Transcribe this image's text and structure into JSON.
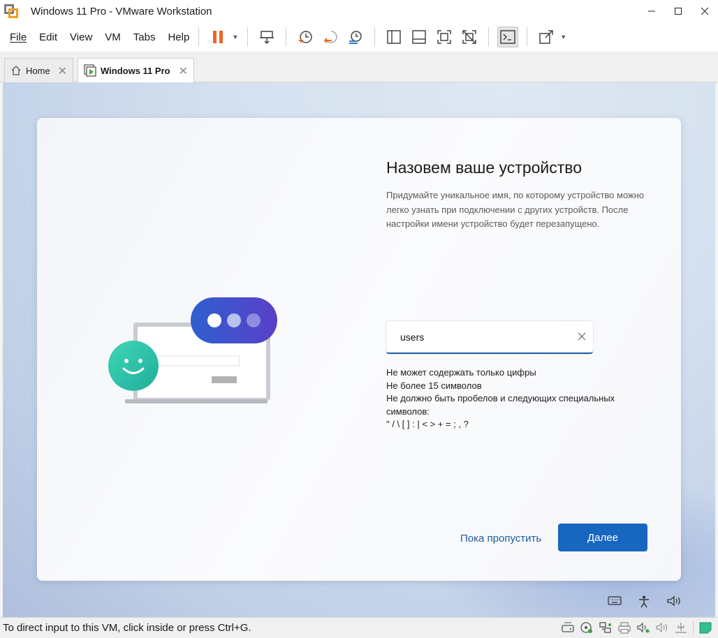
{
  "window": {
    "title": "Windows 11 Pro - VMware Workstation",
    "controls": {
      "minimize": "—",
      "maximize": "☐",
      "close": "✕"
    }
  },
  "menu": {
    "items": [
      "File",
      "Edit",
      "View",
      "VM",
      "Tabs",
      "Help"
    ]
  },
  "toolbar": {
    "icons": [
      "pause-icon",
      "send-ctrl-alt-del-icon",
      "snapshot-icon",
      "revert-snapshot-icon",
      "snapshot-manager-icon",
      "library-view-icon",
      "thumbnail-view-icon",
      "fullscreen-icon",
      "unity-icon",
      "console-icon",
      "stretch-icon"
    ]
  },
  "tabs": [
    {
      "label": "Home",
      "icon": "home-icon"
    },
    {
      "label": "Windows 11 Pro",
      "icon": "vm-running-icon",
      "active": true
    }
  ],
  "oobe": {
    "heading": "Назовем ваше устройство",
    "description": "Придумайте уникальное имя, по которому устройство можно легко узнать при подключении с других устройств. После настройки имени устройство будет перезапущено.",
    "device_name_value": "users",
    "rules": [
      "Не может содержать только цифры",
      "Не более 15 символов",
      "Не должно быть пробелов и следующих специальных символов:",
      "\" / \\ [ ] : | < > + = ; , ?"
    ],
    "skip_label": "Пока пропустить",
    "next_label": "Далее"
  },
  "vm_tray": {
    "icons": [
      "keyboard-icon",
      "accessibility-icon",
      "volume-icon"
    ]
  },
  "statusbar": {
    "text": "To direct input to this VM, click inside or press Ctrl+G.",
    "icons": [
      "hard-disk-icon",
      "cd-rom-icon",
      "network-icon",
      "printer-icon",
      "sound-card-icon",
      "audio-icon",
      "usb-icon",
      "message-icon"
    ]
  },
  "colors": {
    "accent": "#1766c0",
    "pause": "#e8672c",
    "link": "#1b5a9e"
  }
}
